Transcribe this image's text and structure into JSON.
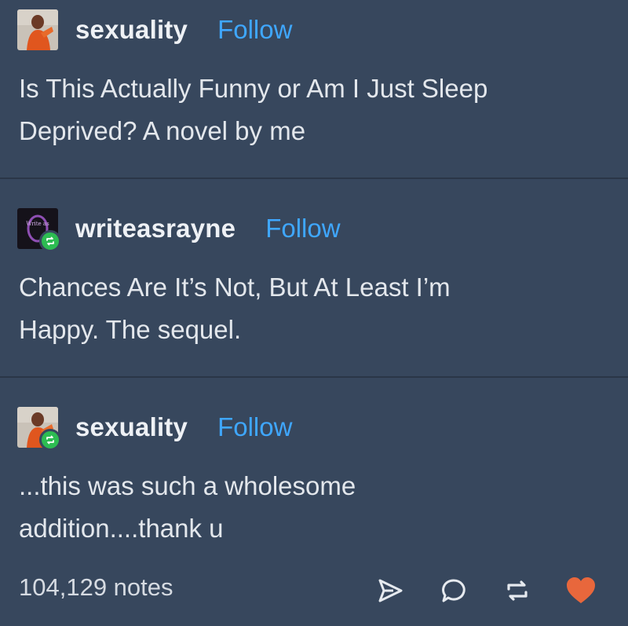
{
  "posts": [
    {
      "username": "sexuality",
      "follow_label": "Follow",
      "text": "Is This Actually Funny or Am I Just Sleep\nDeprived? A novel by me",
      "reblog": false
    },
    {
      "username": "writeasrayne",
      "follow_label": "Follow",
      "text": "Chances Are It’s Not, But At Least I’m\nHappy. The sequel.",
      "reblog": true
    },
    {
      "username": "sexuality",
      "follow_label": "Follow",
      "text": "...this was such a wholesome\naddition....thank u",
      "reblog": true
    }
  ],
  "footer": {
    "notes": "104,129 notes",
    "icons": [
      "share-icon",
      "reply-icon",
      "reblog-icon",
      "like-icon"
    ]
  },
  "colors": {
    "background": "#37475d",
    "follow": "#3fa7ff",
    "reblog_badge": "#2dbc52",
    "like": "#e8673c"
  }
}
